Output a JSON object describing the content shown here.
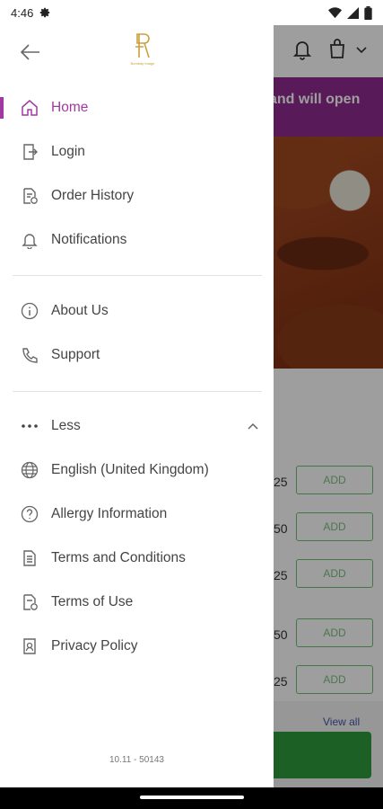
{
  "status_bar": {
    "time": "4:46",
    "icons": [
      "gear-icon",
      "wifi-icon",
      "signal-icon",
      "battery-icon"
    ]
  },
  "background": {
    "banner_text": "and will open",
    "prices": [
      "25",
      "50",
      "25",
      "50",
      "25"
    ],
    "add_label": "ADD",
    "view_all": "View all"
  },
  "drawer": {
    "logo_text": "Bombay Image",
    "menu_primary": [
      {
        "label": "Home",
        "icon": "home-icon",
        "active": true
      },
      {
        "label": "Login",
        "icon": "login-icon"
      },
      {
        "label": "Order History",
        "icon": "order-history-icon"
      },
      {
        "label": "Notifications",
        "icon": "bell-icon"
      }
    ],
    "menu_secondary": [
      {
        "label": "About Us",
        "icon": "info-icon"
      },
      {
        "label": "Support",
        "icon": "phone-icon"
      }
    ],
    "less_label": "Less",
    "menu_more": [
      {
        "label": "English (United Kingdom)",
        "icon": "globe-icon"
      },
      {
        "label": "Allergy Information",
        "icon": "question-icon"
      },
      {
        "label": "Terms and Conditions",
        "icon": "document-icon"
      },
      {
        "label": "Terms of Use",
        "icon": "document-check-icon"
      },
      {
        "label": "Privacy Policy",
        "icon": "privacy-icon"
      }
    ],
    "version": "10.11 - 50143"
  },
  "colors": {
    "accent": "#a03aa0",
    "banner": "#8e2a8e",
    "cart_green": "#2e9b3e"
  }
}
